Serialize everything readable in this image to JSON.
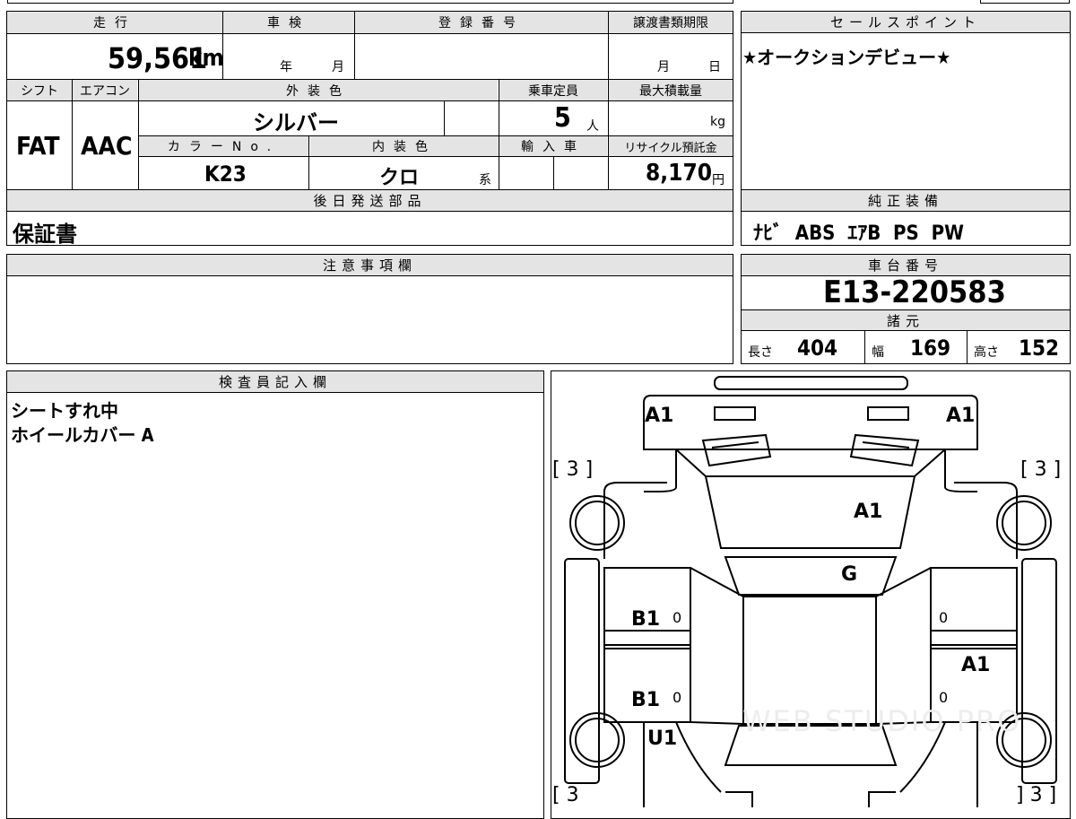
{
  "specs": {
    "mileage_label": "走行",
    "mileage_value": "59,561",
    "mileage_unit": "km",
    "shaken_label": "車検",
    "shaken_year": "年",
    "shaken_month": "月",
    "reg_label": "登録番号",
    "deadline_label": "譲渡書類期限",
    "deadline_month": "月",
    "deadline_day": "日",
    "shift_label": "シフト",
    "shift_value": "FAT",
    "ac_label": "エアコン",
    "ac_value": "AAC",
    "exterior_label": "外装色",
    "exterior_value": "シルバー",
    "capacity_label": "乗車定員",
    "capacity_value": "5",
    "capacity_unit": "人",
    "load_label": "最大積載量",
    "load_unit": "kg",
    "colorno_label": "カラーNo.",
    "colorno_value": "K23",
    "interior_label": "内装色",
    "interior_value": "クロ",
    "interior_suffix": "系",
    "import_label": "輸入車",
    "recycle_label": "リサイクル預託金",
    "recycle_value": "8,170",
    "recycle_unit": "円"
  },
  "sales": {
    "label": "セールスポイント",
    "text": "★オークションデビュー★"
  },
  "later_parts": {
    "label": "後日発送部品",
    "value": "保証書"
  },
  "equipment": {
    "label": "純正装備",
    "value": "ﾅﾋﾞ  ABS  ｴｱB  PS  PW"
  },
  "notes": {
    "label": "注意事項欄"
  },
  "chassis": {
    "label": "車台番号",
    "value": "E13-220583",
    "dims_label": "諸元",
    "length_label": "長さ",
    "length_value": "404",
    "width_label": "幅",
    "width_value": "169",
    "height_label": "高さ",
    "height_value": "152"
  },
  "inspector": {
    "label": "検査員記入欄",
    "line1": "シートすれ中",
    "line2": "ホイールカバー A"
  },
  "diagram": {
    "marks": {
      "front_left": "A1",
      "front_right": "A1",
      "hood": "A1",
      "windshield": "G",
      "left_front_door": "B1",
      "left_rear_door": "B1",
      "left_rear": "U1",
      "right_rear_door": "A1",
      "tire_fl": "[ 3 ]",
      "tire_fr": "[ 3 ]",
      "tire_rl": "[ 3",
      "tire_rr": "] 3 ]",
      "zero": "0"
    },
    "watermark": "WEB STUDIO PRO"
  }
}
